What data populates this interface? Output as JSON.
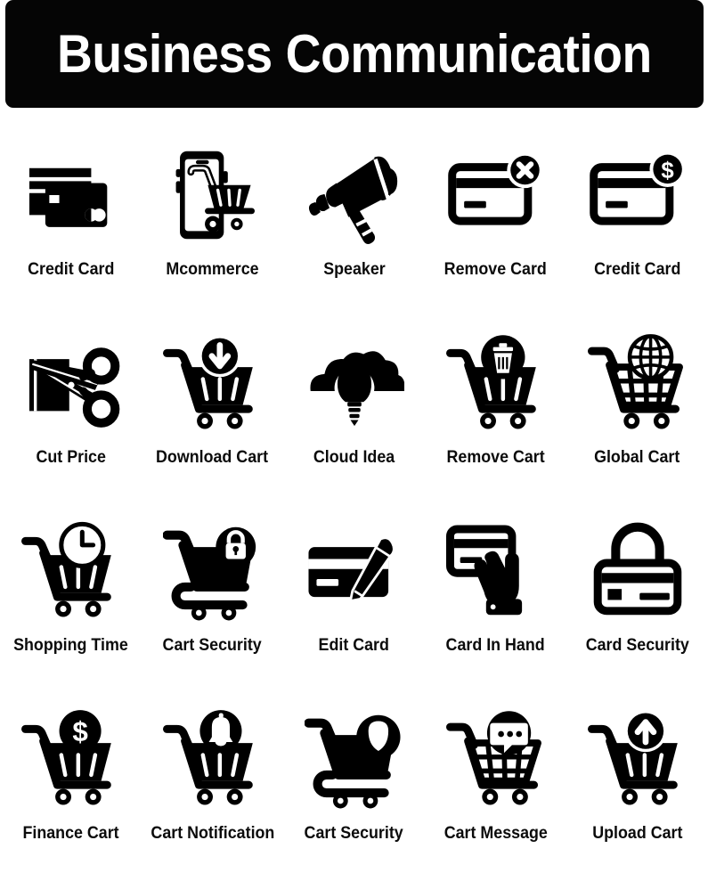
{
  "header": {
    "title": "Business Communication",
    "background_color": "#050505",
    "text_color": "#ffffff"
  },
  "theme": {
    "page_background": "#ffffff",
    "icon_color": "#000000",
    "label_color": "#0b0b0b"
  },
  "grid": {
    "columns": 5,
    "rows": 4,
    "total_icons": 20
  },
  "icons": [
    {
      "label": "Credit Card",
      "icon": "credit-card-stack-icon",
      "row": 1,
      "col": 1
    },
    {
      "label": "Mcommerce",
      "icon": "mobile-commerce-icon",
      "row": 1,
      "col": 2
    },
    {
      "label": "Speaker",
      "icon": "megaphone-speaker-icon",
      "row": 1,
      "col": 3
    },
    {
      "label": "Remove Card",
      "icon": "card-remove-cross-icon",
      "row": 1,
      "col": 4
    },
    {
      "label": "Credit Card",
      "icon": "card-dollar-badge-icon",
      "row": 1,
      "col": 5
    },
    {
      "label": "Cut Price",
      "icon": "card-scissors-cut-icon",
      "row": 2,
      "col": 1
    },
    {
      "label": "Download Cart",
      "icon": "cart-download-arrow-icon",
      "row": 2,
      "col": 2
    },
    {
      "label": "Cloud Idea",
      "icon": "cloud-bulb-idea-icon",
      "row": 2,
      "col": 3
    },
    {
      "label": "Remove Cart",
      "icon": "cart-trash-remove-icon",
      "row": 2,
      "col": 4
    },
    {
      "label": "Global Cart",
      "icon": "cart-globe-icon",
      "row": 2,
      "col": 5
    },
    {
      "label": "Shopping Time",
      "icon": "cart-clock-icon",
      "row": 3,
      "col": 1
    },
    {
      "label": "Cart Security",
      "icon": "cart-padlock-icon",
      "row": 3,
      "col": 2
    },
    {
      "label": "Edit Card",
      "icon": "card-pen-edit-icon",
      "row": 3,
      "col": 3
    },
    {
      "label": "Card In Hand",
      "icon": "card-in-hand-icon",
      "row": 3,
      "col": 4
    },
    {
      "label": "Card Security",
      "icon": "card-padlock-icon",
      "row": 3,
      "col": 5
    },
    {
      "label": "Finance Cart",
      "icon": "cart-dollar-coin-icon",
      "row": 4,
      "col": 1
    },
    {
      "label": "Cart Notification",
      "icon": "cart-bell-notification-icon",
      "row": 4,
      "col": 2
    },
    {
      "label": "Cart Security",
      "icon": "cart-shield-icon",
      "row": 4,
      "col": 3
    },
    {
      "label": "Cart Message",
      "icon": "cart-chat-message-icon",
      "row": 4,
      "col": 4
    },
    {
      "label": "Upload Cart",
      "icon": "cart-upload-arrow-icon",
      "row": 4,
      "col": 5
    }
  ]
}
